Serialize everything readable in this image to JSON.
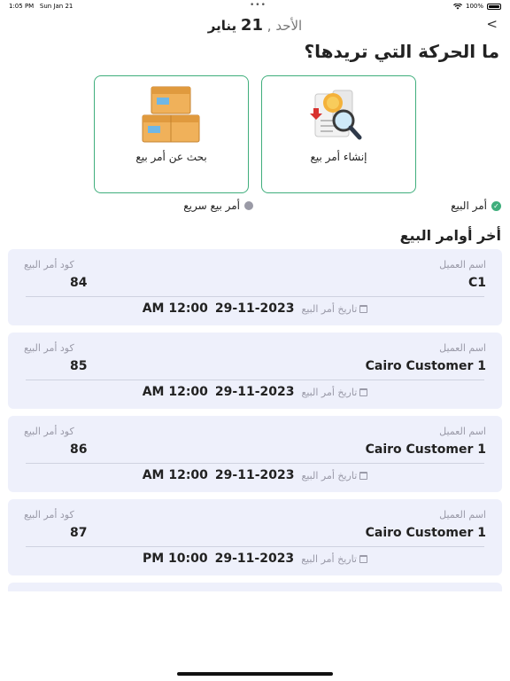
{
  "status_bar": {
    "time": "1:05 PM",
    "date": "Sun Jan 21",
    "battery": "100%"
  },
  "header": {
    "day": "الأحد",
    "separator": ",",
    "day_number": "21",
    "month": "يناير",
    "back_glyph": "<"
  },
  "question": "ما الحركة التي تريدها؟",
  "cards": {
    "create": {
      "label": "إنشاء أمر بيع",
      "icon": "create-document-icon"
    },
    "search": {
      "label": "بحث عن أمر بيع",
      "icon": "boxes-icon"
    }
  },
  "options": {
    "sale_order": "أمر البيع",
    "quick_sale": "أمر بيع سريع"
  },
  "section_title": "أخر أوامر البيع",
  "order_labels": {
    "customer": "اسم العميل",
    "code": "كود أمر البيع",
    "date": "تاريخ أمر البيع"
  },
  "orders": [
    {
      "customer": "C1",
      "code": "84",
      "date": "29-11-2023",
      "time": "AM 12:00"
    },
    {
      "customer": "Cairo Customer 1",
      "code": "85",
      "date": "29-11-2023",
      "time": "AM 12:00"
    },
    {
      "customer": "Cairo Customer 1",
      "code": "86",
      "date": "29-11-2023",
      "time": "AM 12:00"
    },
    {
      "customer": "Cairo Customer 1",
      "code": "87",
      "date": "29-11-2023",
      "time": "PM 10:00"
    }
  ],
  "colors": {
    "accent": "#3fae7c",
    "card_bg": "#eef0fb",
    "muted": "#9a9aa8"
  }
}
